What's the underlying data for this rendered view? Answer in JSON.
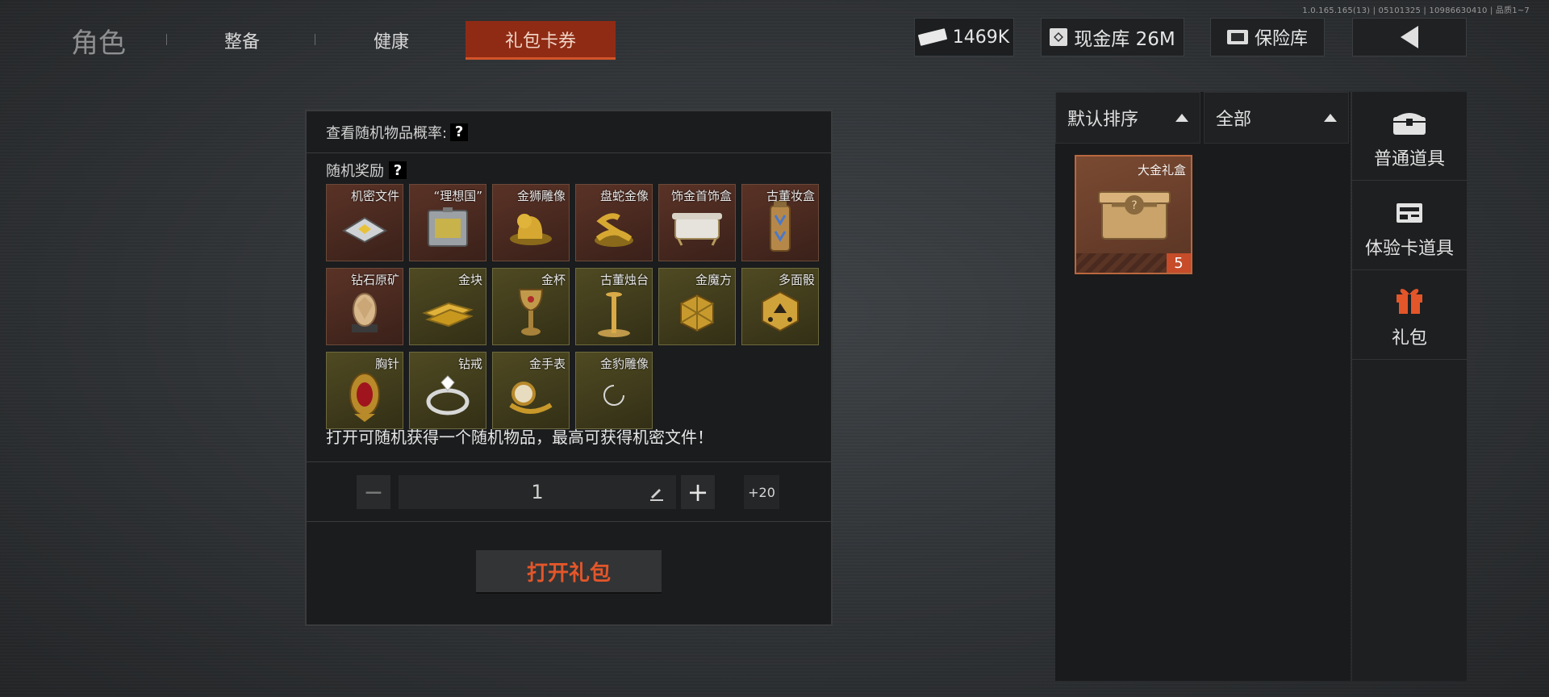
{
  "version": "1.0.165.165(13) | 05101325 | 10986630410 | 品质1~7",
  "tabs": {
    "role": "角色",
    "gear": "整备",
    "health": "健康",
    "gift": "礼包卡券"
  },
  "header": {
    "money": "1469K",
    "vault": "现金库 26M",
    "safe": "保险库"
  },
  "panel": {
    "prob_label": "查看随机物品概率:",
    "help_glyph": "?",
    "reward_title": "随机奖励",
    "items": [
      {
        "label": "机密文件",
        "rarity": "red"
      },
      {
        "label": "“理想国”",
        "rarity": "red"
      },
      {
        "label": "金狮雕像",
        "rarity": "red"
      },
      {
        "label": "盘蛇金像",
        "rarity": "red"
      },
      {
        "label": "饰金首饰盒",
        "rarity": "red"
      },
      {
        "label": "古董妆盒",
        "rarity": "red"
      },
      {
        "label": "钻石原矿",
        "rarity": "red"
      },
      {
        "label": "金块",
        "rarity": "gold"
      },
      {
        "label": "金杯",
        "rarity": "gold"
      },
      {
        "label": "古董烛台",
        "rarity": "gold"
      },
      {
        "label": "金魔方",
        "rarity": "gold"
      },
      {
        "label": "多面骰",
        "rarity": "gold"
      },
      {
        "label": "胸针",
        "rarity": "gold"
      },
      {
        "label": "钻戒",
        "rarity": "gold"
      },
      {
        "label": "金手表",
        "rarity": "gold"
      },
      {
        "label": "金豹雕像",
        "rarity": "gold"
      }
    ],
    "description": "打开可随机获得一个随机物品，最高可获得机密文件！",
    "quantity": "1",
    "minus_glyph": "−",
    "plus_glyph": "+",
    "plus20": "+20",
    "open_button": "打开礼包"
  },
  "inventory": {
    "sort_label": "默认排序",
    "filter_label": "全部",
    "item_label": "大金礼盒",
    "item_count": "5"
  },
  "categories": [
    {
      "label": "普通道具",
      "icon": "chest-icon"
    },
    {
      "label": "体验卡道具",
      "icon": "card-icon"
    },
    {
      "label": "礼包",
      "icon": "gift-icon"
    }
  ],
  "colors": {
    "accent": "#d2542a",
    "tab_active_bg": "#8f2b14",
    "rarity_red": "#5a3226",
    "rarity_gold": "#4f4a22"
  }
}
